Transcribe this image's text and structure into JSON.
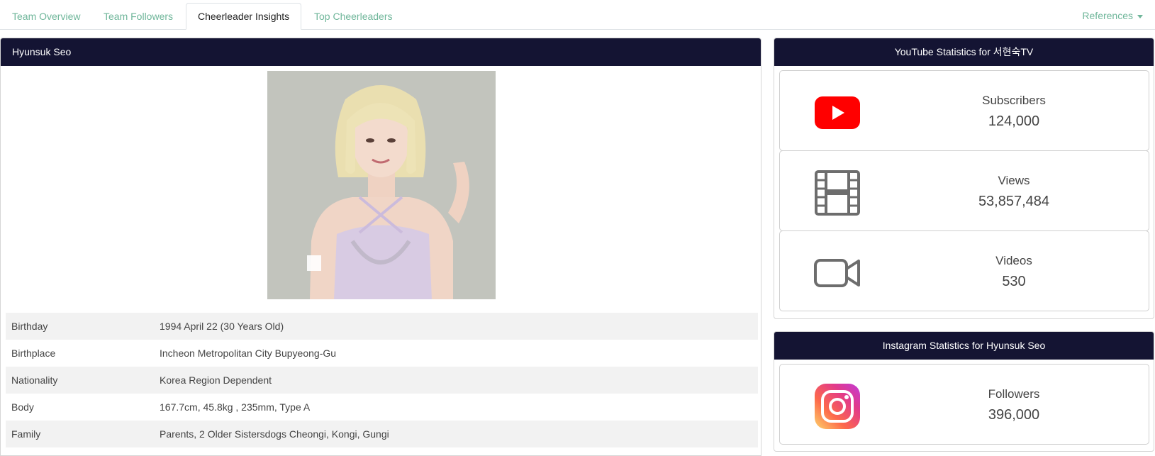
{
  "tabs": {
    "team_overview": "Team Overview",
    "team_followers": "Team Followers",
    "cheerleader_insights": "Cheerleader Insights",
    "top_cheerleaders": "Top Cheerleaders",
    "references": "References"
  },
  "profile": {
    "name": "Hyunsuk Seo",
    "rows": [
      {
        "key": "Birthday",
        "value": "1994 April 22 (30 Years Old)"
      },
      {
        "key": "Birthplace",
        "value": "Incheon Metropolitan City Bupyeong-Gu"
      },
      {
        "key": "Nationality",
        "value": "Korea Region Dependent"
      },
      {
        "key": "Body",
        "value": "167.7cm, 45.8kg , 235mm, Type A"
      },
      {
        "key": "Family",
        "value": "Parents, 2 Older Sistersdogs Cheongi, Kongi, Gungi"
      }
    ]
  },
  "youtube": {
    "title": "YouTube Statistics for 서현숙TV",
    "subscribers_label": "Subscribers",
    "subscribers_value": "124,000",
    "views_label": "Views",
    "views_value": "53,857,484",
    "videos_label": "Videos",
    "videos_value": "530"
  },
  "instagram": {
    "title": "Instagram Statistics for Hyunsuk Seo",
    "followers_label": "Followers",
    "followers_value": "396,000"
  },
  "icons": {
    "youtube": "youtube-logo-icon",
    "views": "film-icon",
    "videos": "video-camera-icon",
    "instagram": "instagram-logo-icon"
  },
  "colors": {
    "header_bg": "#141433",
    "tab_link": "#6fb69a",
    "youtube_red": "#ff0000",
    "icon_gray": "#6d6d6d"
  }
}
